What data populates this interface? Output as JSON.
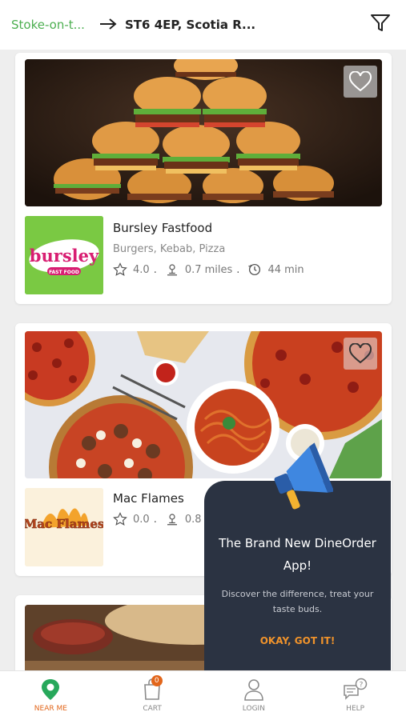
{
  "header": {
    "city": "Stoke-on-t...",
    "arrow_icon": "arrow-right-icon",
    "postcode": "ST6 4EP, Scotia R...",
    "filter_icon": "filter-icon"
  },
  "restaurants": [
    {
      "name": "Bursley Fastfood",
      "cuisine": "Burgers, Kebab, Pizza",
      "rating": "4.0",
      "distance": "0.7 miles",
      "time": "44 min",
      "logo_text": "bursley",
      "logo_subtext": "FAST FOOD"
    },
    {
      "name": "Mac Flames",
      "rating": "0.0",
      "distance": "0.8",
      "logo_text": "Mac Flames"
    }
  ],
  "separator": ".",
  "popup": {
    "title": "The Brand New DineOrder App!",
    "subtitle": "Discover the difference, treat your taste buds.",
    "button": "OKAY, GOT IT!"
  },
  "nav": [
    {
      "label": "NEAR ME",
      "icon": "location-pin-icon"
    },
    {
      "label": "CART",
      "icon": "cart-bag-icon",
      "badge": "0"
    },
    {
      "label": "LOGIN",
      "icon": "user-icon"
    },
    {
      "label": "HELP",
      "icon": "help-chat-icon"
    }
  ],
  "colors": {
    "accent_green": "#4caf50",
    "accent_orange": "#e2661b",
    "popup_bg": "#2b3342",
    "popup_button": "#f0932b"
  }
}
